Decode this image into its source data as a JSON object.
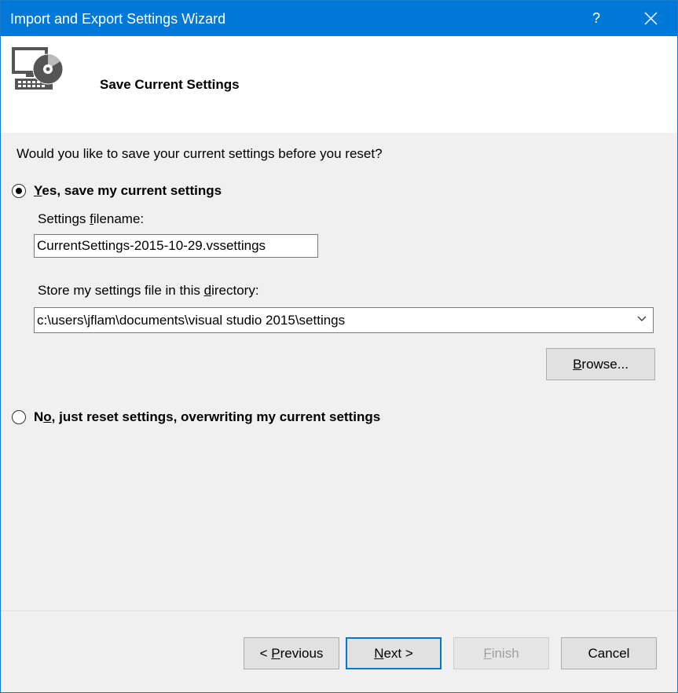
{
  "window": {
    "title": "Import and Export Settings Wizard",
    "help_glyph": "?",
    "accent_color": "#0078d7"
  },
  "header": {
    "heading": "Save Current Settings",
    "icon": "settings-wizard-icon"
  },
  "content": {
    "question": "Would you like to save your current settings before you reset?",
    "option_yes": {
      "prefix": "",
      "mnemonic": "Y",
      "rest": "es, save my current settings",
      "selected": true
    },
    "filename_label": {
      "prefix": "Settings ",
      "mnemonic": "f",
      "rest": "ilename:"
    },
    "filename_value": "CurrentSettings-2015-10-29.vssettings",
    "directory_label": {
      "prefix": "Store my settings file in this ",
      "mnemonic": "d",
      "rest": "irectory:"
    },
    "directory_value": "c:\\users\\jflam\\documents\\visual studio 2015\\settings",
    "browse_button": {
      "prefix": "",
      "mnemonic": "B",
      "rest": "rowse..."
    },
    "option_no": {
      "prefix": "N",
      "mnemonic": "o",
      "rest": ", just reset settings, overwriting my current settings",
      "selected": false
    }
  },
  "footer": {
    "previous": {
      "prefix": "< ",
      "mnemonic": "P",
      "rest": "revious"
    },
    "next": {
      "prefix": "",
      "mnemonic": "N",
      "rest": "ext >"
    },
    "finish": {
      "prefix": "",
      "mnemonic": "F",
      "rest": "inish",
      "disabled": true
    },
    "cancel": "Cancel"
  }
}
